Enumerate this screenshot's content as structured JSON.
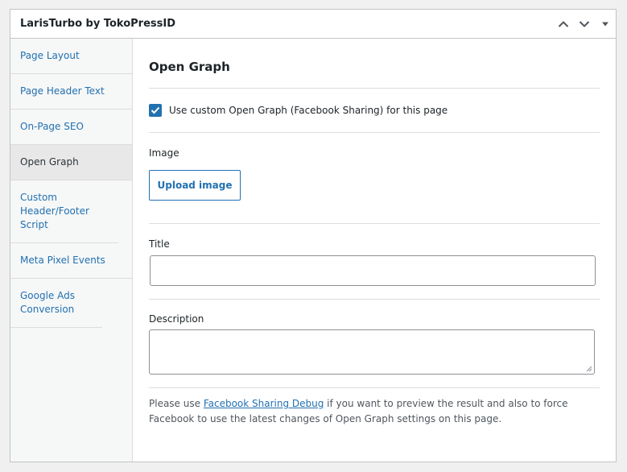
{
  "panel": {
    "title": "LarisTurbo by TokoPressID",
    "icons": [
      "chevron-up-icon",
      "chevron-down-icon",
      "caret-down-icon"
    ]
  },
  "sidebar": {
    "items": [
      {
        "label": "Page Layout",
        "active": false
      },
      {
        "label": "Page Header Text",
        "active": false
      },
      {
        "label": "On-Page SEO",
        "active": false
      },
      {
        "label": "Open Graph",
        "active": true
      },
      {
        "label": "Custom Header/Footer Script",
        "active": false
      },
      {
        "label": "Meta Pixel Events",
        "active": false
      },
      {
        "label": "Google Ads Conversion",
        "active": false
      }
    ]
  },
  "main": {
    "section_title": "Open Graph",
    "custom_og_checkbox": {
      "label": "Use custom Open Graph (Facebook Sharing) for this page",
      "checked": true
    },
    "image": {
      "label": "Image",
      "upload_button": "Upload image"
    },
    "title_field": {
      "label": "Title",
      "value": "",
      "placeholder": ""
    },
    "description_field": {
      "label": "Description",
      "value": "",
      "placeholder": ""
    },
    "help": {
      "before": "Please use ",
      "link": "Facebook Sharing Debug",
      "after": " if you want to preview the result and also to force Facebook to use the latest changes of Open Graph settings on this page."
    }
  },
  "colors": {
    "accent": "#2271b1",
    "border": "#c3c4c7",
    "sidebar_bg": "#f6f7f7",
    "active_item_bg": "#e8e8e8"
  }
}
